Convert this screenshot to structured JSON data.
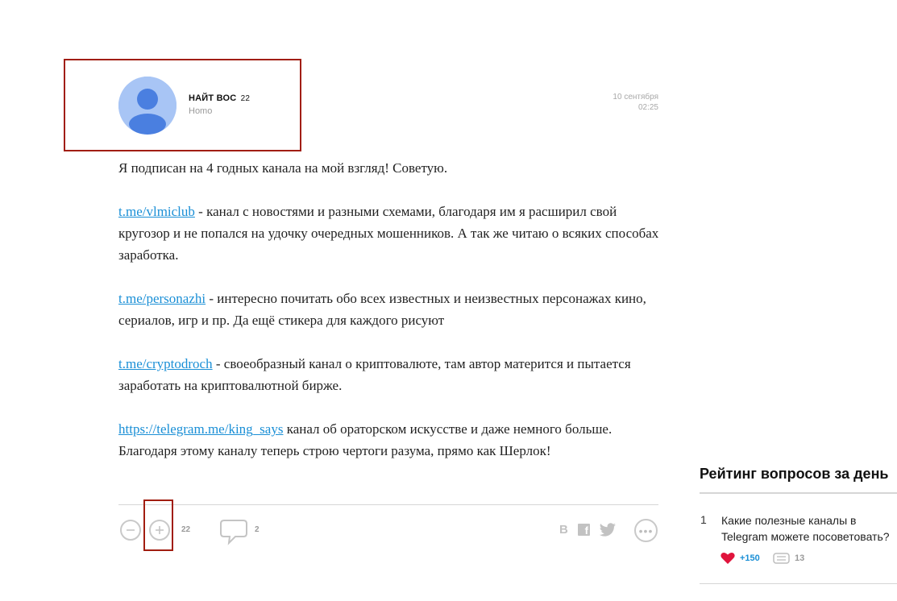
{
  "author": {
    "name": "НАЙТ ВОС",
    "score": "22",
    "subtitle": "Homo"
  },
  "post": {
    "date": "10 сентября",
    "time": "02:25",
    "intro": "Я подписан на 4 годных канала на мой взгляд! Советую.",
    "channels": [
      {
        "link": "t.me/vlmiclub",
        "text": " - канал с новостями и разными схемами, благодаря им я расширил свой кругозор и не попался на удочку очередных мошенников. А так же читаю о всяких способах заработка."
      },
      {
        "link": "t.me/personazhi",
        "text": " - интересно почитать обо всех известных и неизвестных персонажах кино, сериалов, игр и пр. Да ещё стикера для каждого рисуют"
      },
      {
        "link": "t.me/cryptodroch",
        "text": " - своеобразный канал о криптовалюте, там автор матерится и пытается заработать на криптовалютной бирже."
      },
      {
        "link": "https://telegram.me/king_says",
        "text": " канал об ораторском искусстве и даже немного больше."
      }
    ],
    "outro": "Благодаря этому каналу теперь строю чертоги разума, прямо как Шерлок!"
  },
  "actions": {
    "minus_icon": "minus-icon",
    "plus_icon": "plus-icon",
    "vote_count": "22",
    "comment_icon": "speech-bubble-icon",
    "comment_count": "2",
    "share_vk": "В",
    "share_fb": "f",
    "share_twitter_icon": "twitter-icon",
    "more_icon": "ellipsis-icon",
    "more_label": "•••"
  },
  "sidebar": {
    "title": "Рейтинг вопросов за день",
    "items": [
      {
        "rank": "1",
        "question_line1": "Какие полезные каналы в",
        "question_line2": "Telegram можете посоветовать?",
        "likes": "+150",
        "comments": "13"
      }
    ]
  },
  "colors": {
    "highlight_border": "#a11d10",
    "link": "#1a8fd6",
    "avatar_bg": "#a8c5f5",
    "avatar_fg": "#4a7fe0",
    "heart": "#e0143c"
  }
}
